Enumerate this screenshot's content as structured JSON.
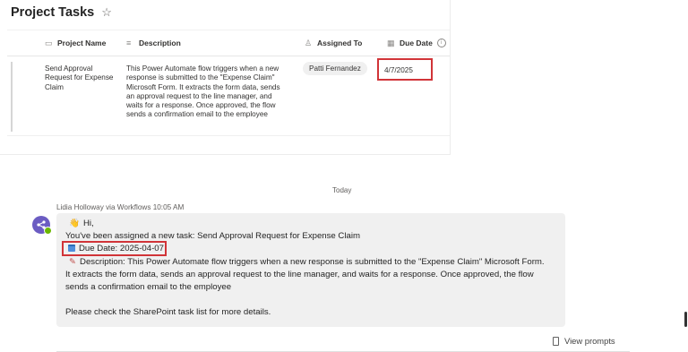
{
  "list": {
    "title": "Project Tasks",
    "columns": {
      "project_name": "Project Name",
      "description": "Description",
      "assigned_to": "Assigned To",
      "due_date": "Due Date"
    },
    "row": {
      "project_name_lines": [
        "Send Approval",
        "Request for Expense",
        "Claim"
      ],
      "description_lines": [
        "This Power Automate flow triggers when a new",
        "response is submitted to the \"Expense Claim\"",
        "Microsoft Form. It extracts the form data, sends",
        "an approval request to the line manager, and",
        "waits for a response. Once approved, the flow",
        "sends a confirmation email to the employee"
      ],
      "assigned_to": "Patti Fernandez",
      "due_date": "4/7/2025"
    }
  },
  "chat": {
    "day_divider": "Today",
    "sender_line": "Lidia Holloway via Workflows  10:05 AM",
    "message": {
      "greeting": "Hi,",
      "line_assigned": "You've been assigned a new task: Send Approval Request for Expense Claim",
      "line_due": "Due Date: 2025-04-07",
      "description_lines": [
        "Description: This Power Automate flow triggers when a new response is submitted to the \"Expense Claim\" Microsoft Form.",
        "It extracts the form data, sends an approval request to the line manager, and waits for a response. Once approved, the flow",
        "sends a confirmation email to the employee"
      ],
      "footer": "Please check the SharePoint task list for more details."
    },
    "view_prompts": "View prompts"
  },
  "colors": {
    "highlight_border": "#d13438",
    "bubble_bg": "#f0f0f0",
    "avatar_bg": "#6b5cc2"
  },
  "icons": {
    "favorite": "star-icon",
    "title_col": "text-icon",
    "desc_col": "multiline-text-icon",
    "person_col": "person-icon",
    "date_col": "calendar-icon",
    "info": "info-icon",
    "wave": "wave-emoji-icon",
    "calendar": "calendar-emoji-icon",
    "pencil": "pencil-emoji-icon",
    "prompts": "document-icon"
  }
}
